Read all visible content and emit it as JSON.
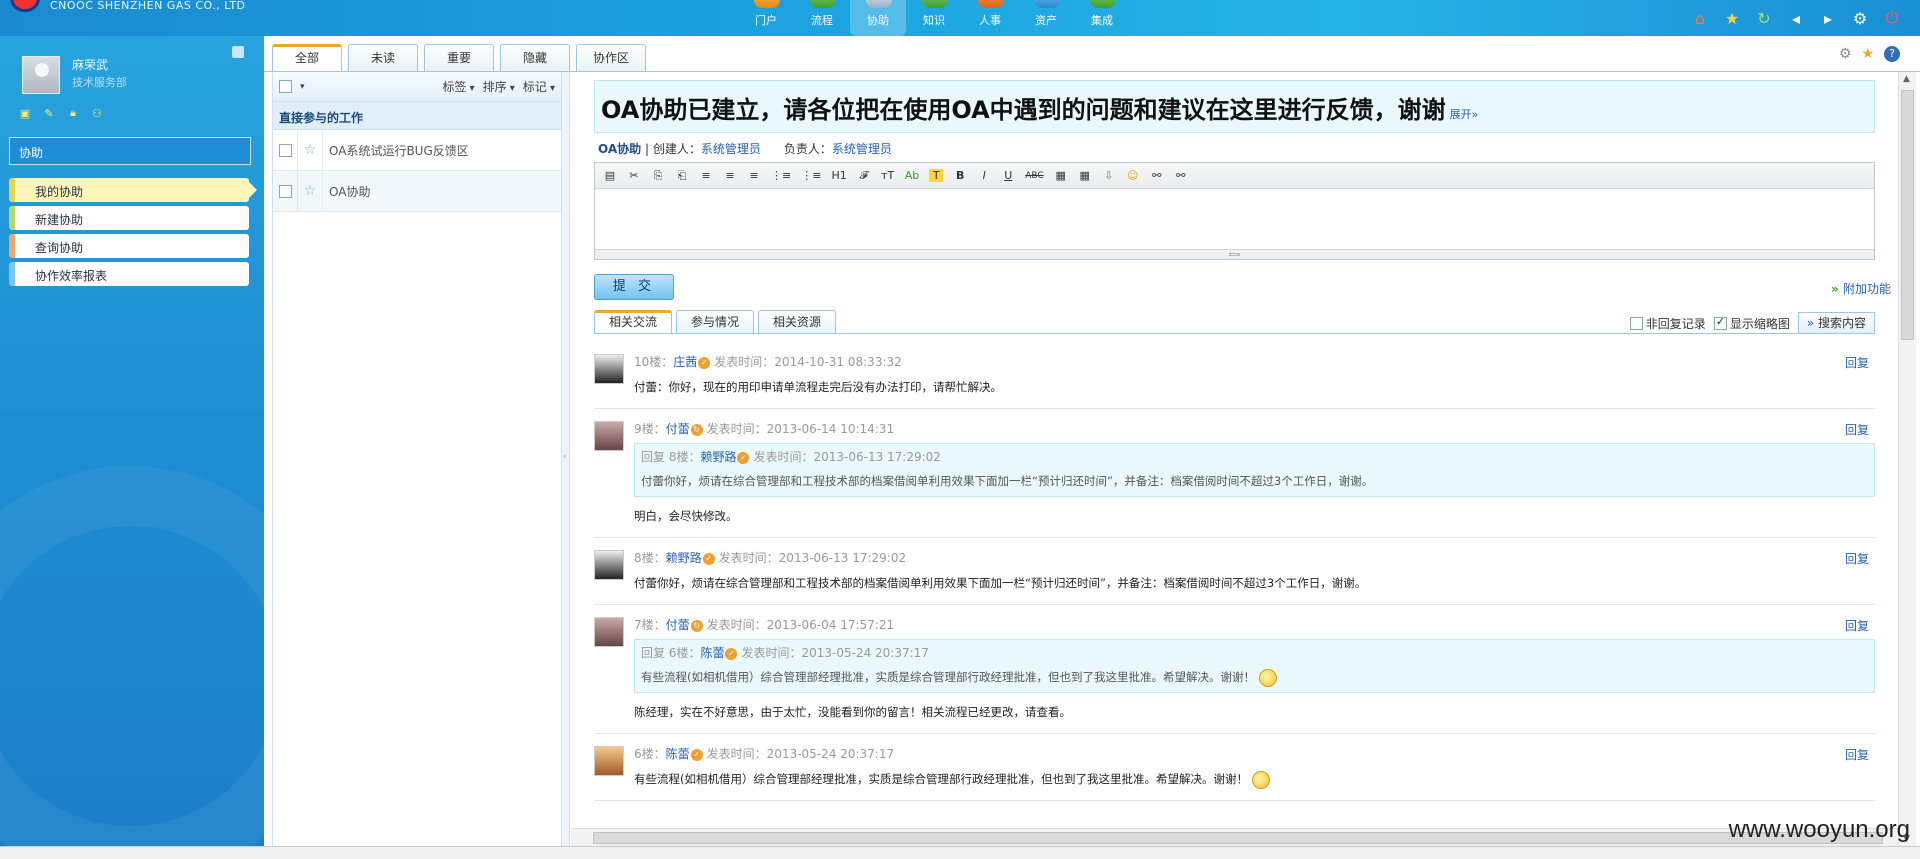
{
  "header": {
    "company": "CNOOC SHENZHEN GAS CO., LTD",
    "modules": [
      "门户",
      "流程",
      "协助",
      "知识",
      "人事",
      "资产",
      "集成"
    ],
    "active_module": 2
  },
  "user": {
    "name": "麻荣武",
    "dept": "技术服务部"
  },
  "sidebar": {
    "module_title": "协助",
    "menu": [
      "我的协助",
      "新建协助",
      "查询协助",
      "协作效率报表"
    ]
  },
  "tabs": [
    "全部",
    "未读",
    "重要",
    "隐藏",
    "协作区"
  ],
  "list": {
    "toolbar": {
      "tag": "标签",
      "sort": "排序",
      "mark": "标记"
    },
    "group": "直接参与的工作",
    "rows": [
      "OA系统试运行BUG反馈区",
      "OA协助"
    ]
  },
  "topic": {
    "title": "OA协助已建立，请各位把在使用OA中遇到的问题和建议在这里进行反馈，谢谢",
    "expand": "展开»",
    "category": "OA协助",
    "creator_label": "创建人：",
    "creator": "系统管理员",
    "owner_label": "负责人：",
    "owner": "系统管理员"
  },
  "editor": {
    "tools": [
      "▤",
      "✂",
      "⎘",
      "⎗",
      "≡",
      "≡",
      "≡",
      "⋮≡",
      "⋮≡",
      "H1",
      "𝓕",
      "тT",
      "Ab",
      "T",
      "B",
      "I",
      "U",
      "ABC",
      "▦",
      "▦",
      "⇩",
      "☺",
      "⚯",
      "⚯"
    ]
  },
  "actions": {
    "submit": "提 交",
    "addon": "附加功能"
  },
  "subtabs": [
    "相关交流",
    "参与情况",
    "相关资源"
  ],
  "filters": {
    "non_reply": "非回复记录",
    "show_thumb": "显示缩略图",
    "search": "搜索内容"
  },
  "posts": [
    {
      "floor": "10楼：",
      "author": "庄茜",
      "time_label": "发表时间：",
      "time": "2014-10-31 08:33:32",
      "reply": "回复",
      "body": "付蕾：你好，现在的用印申请单流程走完后没有办法打印，请帮忙解决。"
    },
    {
      "floor": "9楼：",
      "author": "付蕾",
      "time_label": "发表时间：",
      "time": "2013-06-14 10:14:31",
      "reply": "回复",
      "quote": {
        "prefix": "回复 8楼：",
        "author": "赖野路",
        "time_label": "发表时间：",
        "time": "2013-06-13 17:29:02",
        "body": "付蕾你好，烦请在综合管理部和工程技术部的档案借阅单利用效果下面加一栏“预计归还时间”，并备注：档案借阅时间不超过3个工作日，谢谢。"
      },
      "body": "明白，会尽快修改。"
    },
    {
      "floor": "8楼：",
      "author": "赖野路",
      "time_label": "发表时间：",
      "time": "2013-06-13 17:29:02",
      "reply": "回复",
      "body": "付蕾你好，烦请在综合管理部和工程技术部的档案借阅单利用效果下面加一栏“预计归还时间”，并备注：档案借阅时间不超过3个工作日，谢谢。"
    },
    {
      "floor": "7楼：",
      "author": "付蕾",
      "time_label": "发表时间：",
      "time": "2013-06-04 17:57:21",
      "reply": "回复",
      "quote": {
        "prefix": "回复 6楼：",
        "author": "陈蕾",
        "time_label": "发表时间：",
        "time": "2013-05-24 20:37:17",
        "body": "有些流程(如相机借用）综合管理部经理批准，实质是综合管理部行政经理批准，但也到了我这里批准。希望解决。谢谢！"
      },
      "body": "陈经理，实在不好意思，由于太忙，没能看到你的留言！相关流程已经更改，请查看。"
    },
    {
      "floor": "6楼：",
      "author": "陈蕾",
      "time_label": "发表时间：",
      "time": "2013-05-24 20:37:17",
      "reply": "回复",
      "body": "有些流程(如相机借用）综合管理部经理批准，实质是综合管理部行政经理批准，但也到了我这里批准。希望解决。谢谢！"
    }
  ],
  "watermark": "www.wooyun.org"
}
